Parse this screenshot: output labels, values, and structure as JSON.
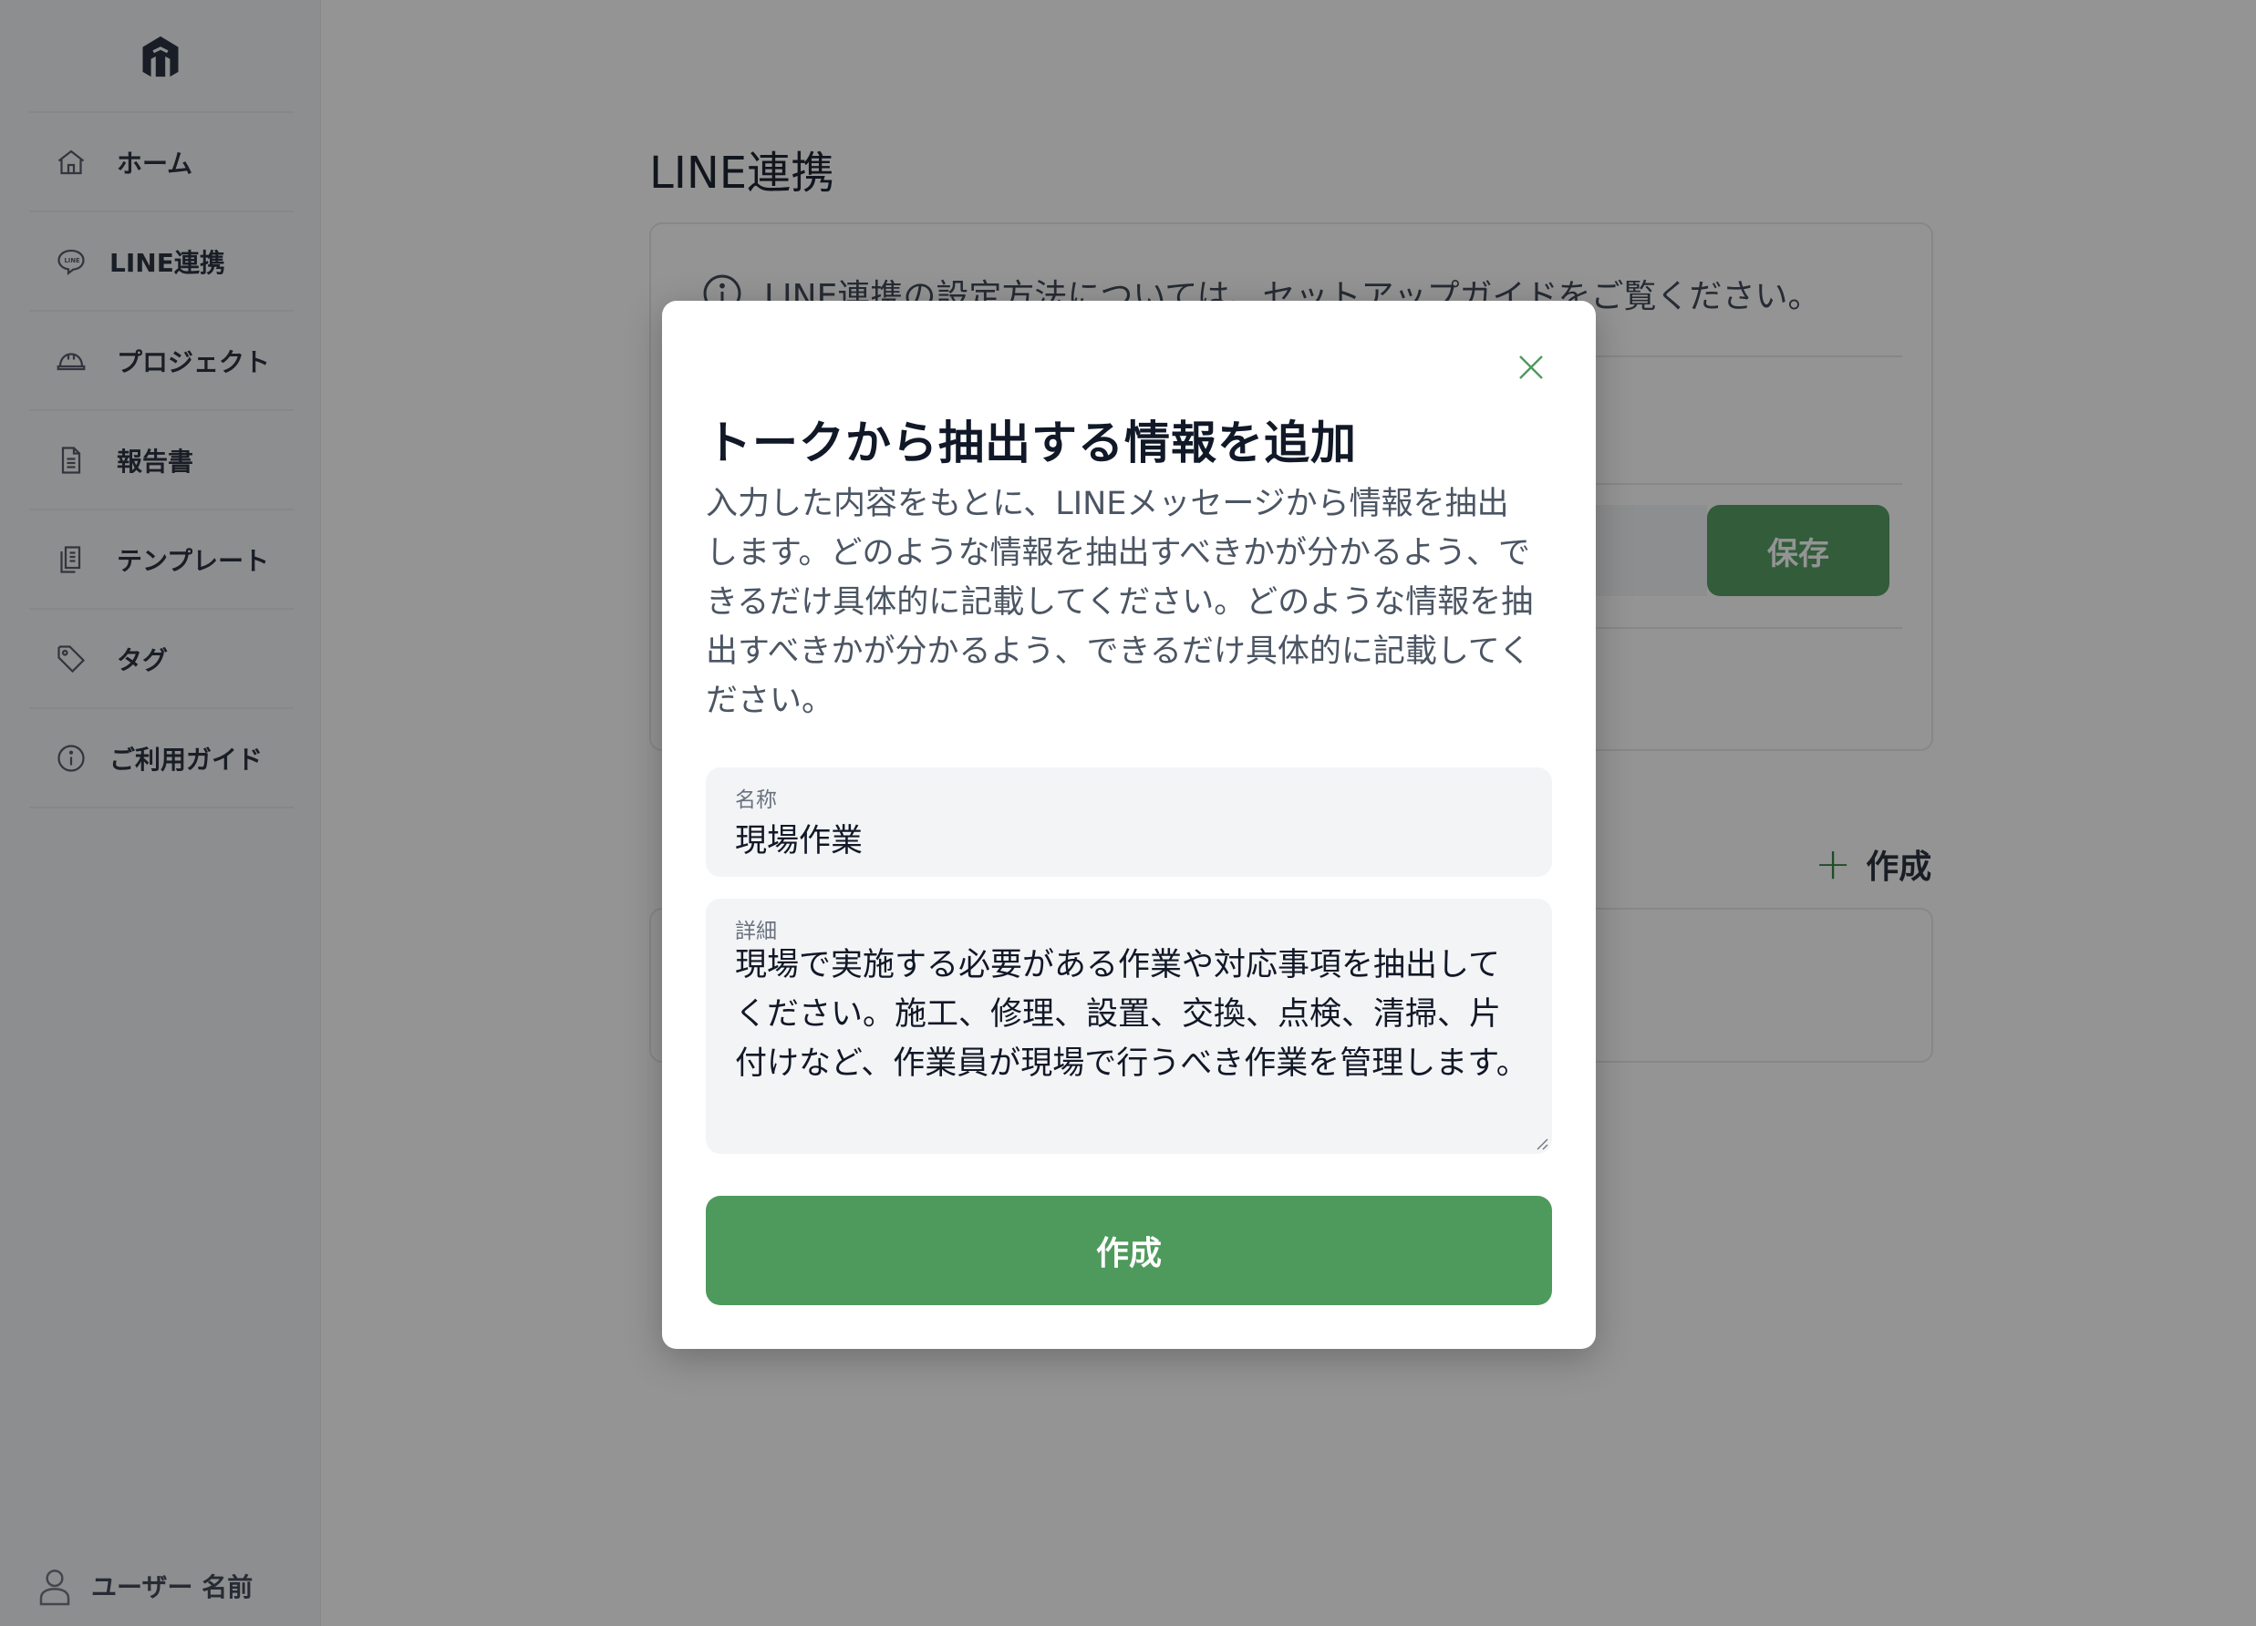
{
  "sidebar": {
    "logo_icon": "building-logo-icon",
    "items": [
      {
        "label": "ホーム",
        "icon": "home-icon"
      },
      {
        "label": "LINE連携",
        "icon": "line-chat-icon"
      },
      {
        "label": "プロジェクト",
        "icon": "hardhat-icon"
      },
      {
        "label": "報告書",
        "icon": "document-icon"
      },
      {
        "label": "テンプレート",
        "icon": "template-icon"
      },
      {
        "label": "タグ",
        "icon": "tag-icon"
      },
      {
        "label": "ご利用ガイド",
        "icon": "info-icon"
      }
    ],
    "user_name": "ユーザー 名前"
  },
  "main": {
    "title": "LINE連携",
    "info_text": "LINE連携の設定方法については、セットアップガイドをご覧ください。",
    "save_label": "保存",
    "create_label": "作成"
  },
  "modal": {
    "title": "トークから抽出する情報を追加",
    "description": "入力した内容をもとに、LINEメッセージから情報を抽出します。どのような情報を抽出すべきかが分かるよう、できるだけ具体的に記載してください。どのような情報を抽出すべきかが分かるよう、できるだけ具体的に記載してください。",
    "name_label": "名称",
    "name_value": "現場作業",
    "detail_label": "詳細",
    "detail_value": "現場で実施する必要がある作業や対応事項を抽出してください。施工、修理、設置、交換、点検、清掃、片付けなど、作業員が現場で行うべき作業を管理します。",
    "submit_label": "作成"
  },
  "colors": {
    "accent": "#4e9a5c",
    "overlay": "rgba(17,17,17,0.45)"
  }
}
